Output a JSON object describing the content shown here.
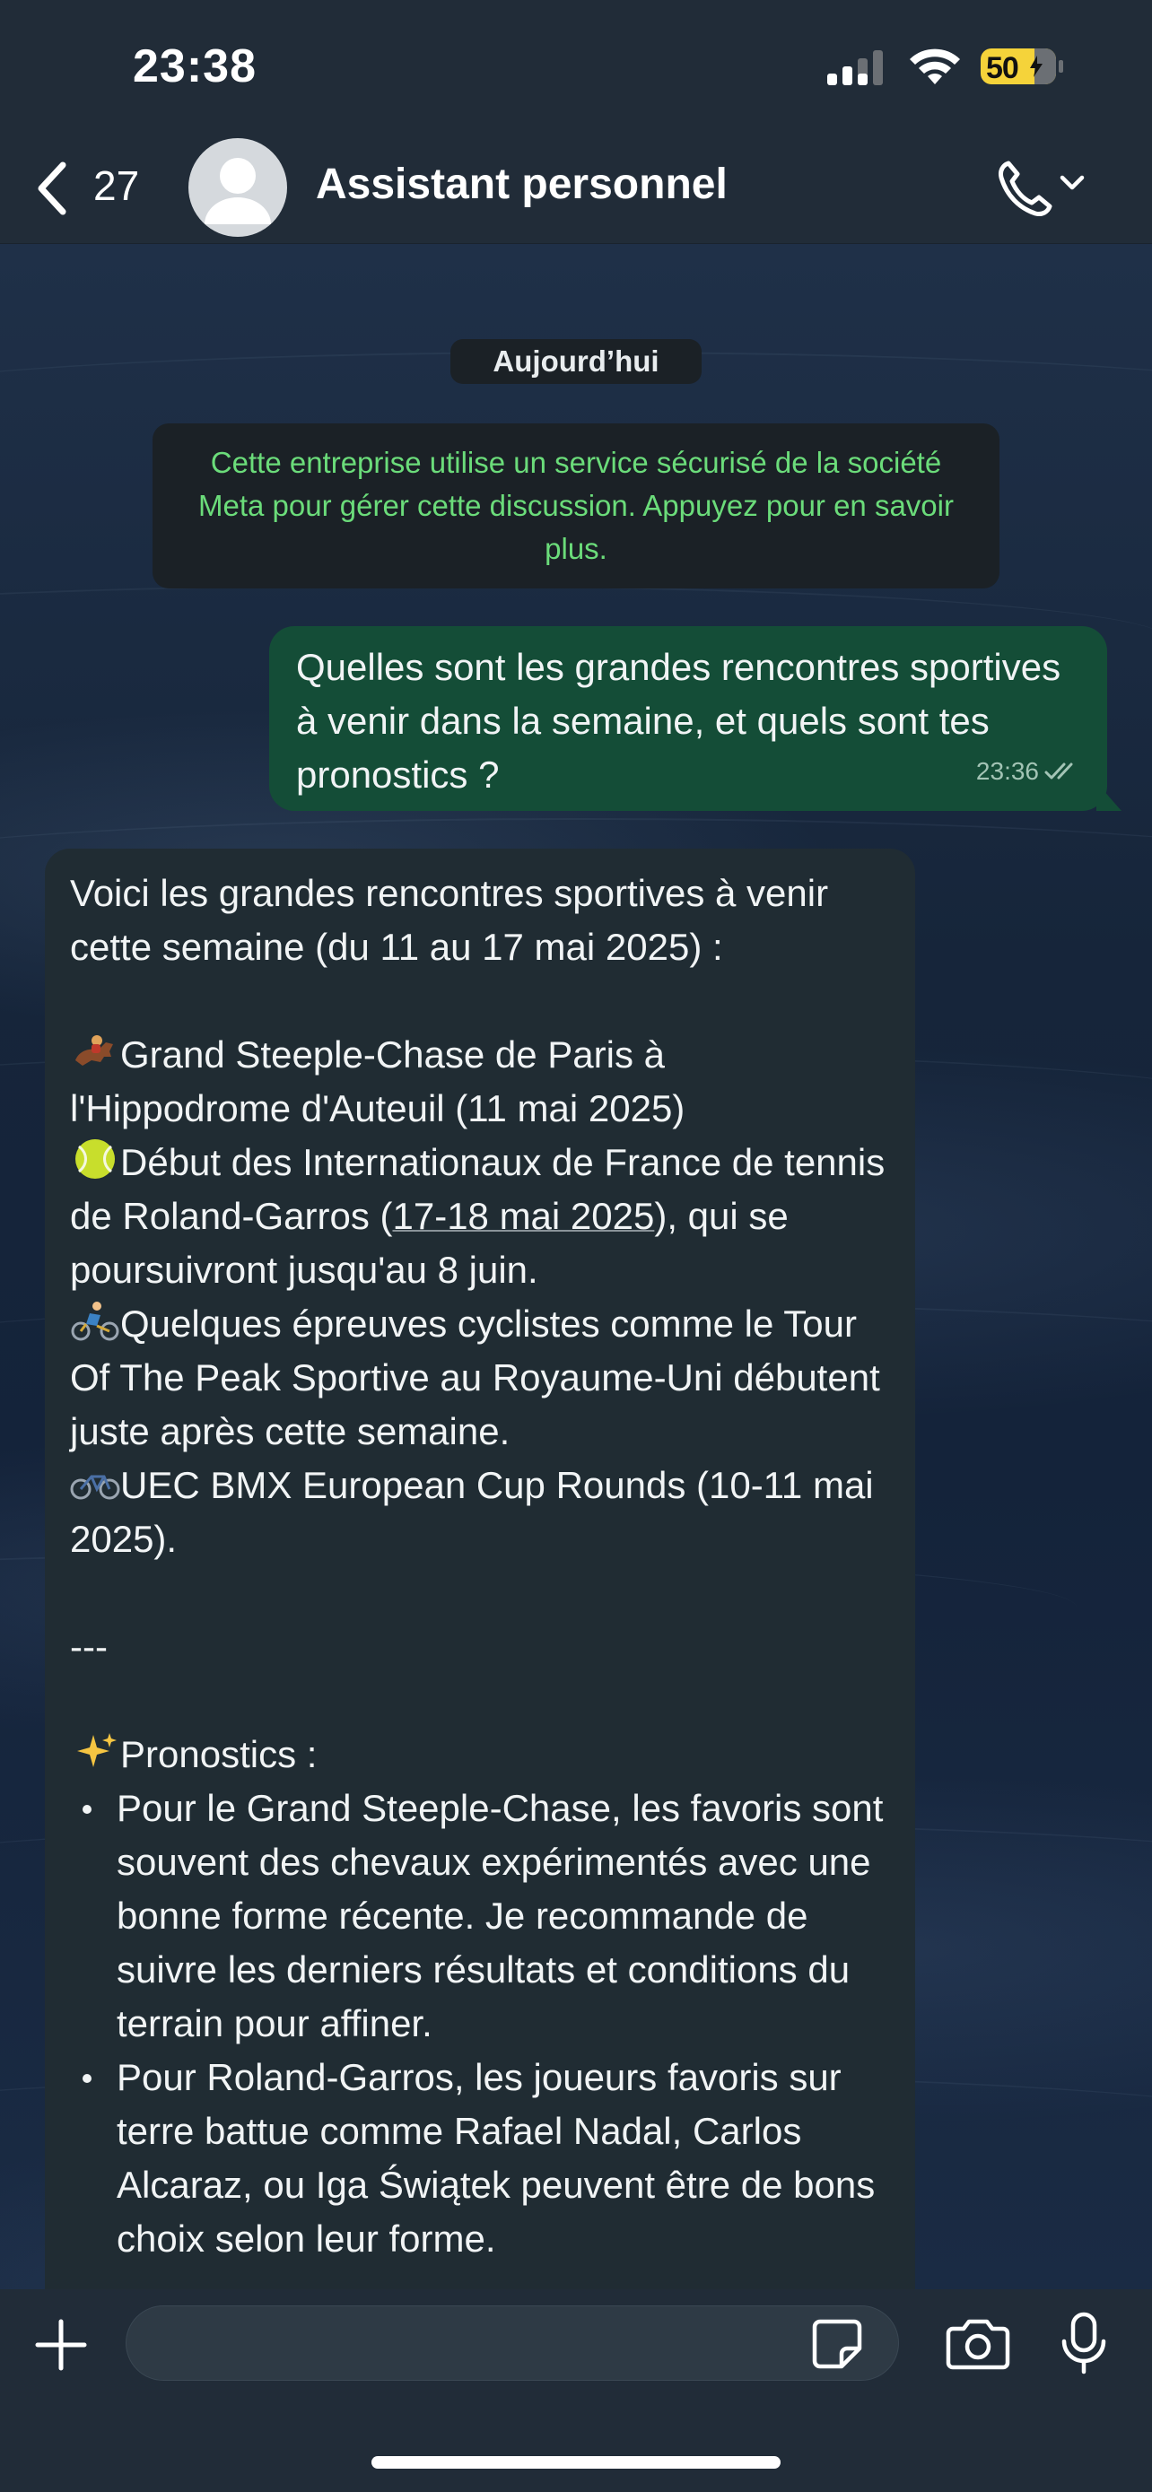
{
  "status_bar": {
    "time": "23:38",
    "battery_percent": "50"
  },
  "header": {
    "back_count": "27",
    "contact_name": "Assistant personnel"
  },
  "chat": {
    "date_chip": "Aujourd’hui",
    "notice": "Cette entreprise utilise un service sécurisé de la société Meta pour gérer cette discussion. Appuyez pour en savoir plus.",
    "outgoing": {
      "text": "Quelles sont les grandes rencontres sportives à venir dans la semaine, et quels sont tes pronostics ?",
      "time": "23:36"
    },
    "incoming": {
      "intro": "Voici les grandes rencontres sportives à venir cette semaine (du 11 au 17 mai 2025) :",
      "item1": "Grand Steeple-Chase de Paris à l'Hippodrome d'Auteuil (11 mai 2025)",
      "item2_a": "Début des Internationaux de France de tennis de Roland-Garros (",
      "item2_link": "17-18 mai 2025",
      "item2_b": "), qui se poursuivront jusqu'au 8 juin.",
      "item3": "Quelques épreuves cyclistes comme le Tour Of The Peak Sportive au Royaume-Uni débutent juste après cette semaine.",
      "item4": "UEC BMX European Cup Rounds (10-11 mai 2025).",
      "separator": "---",
      "pronostics_title": "Pronostics :",
      "bullet1": "Pour le Grand Steeple-Chase, les favoris sont souvent des chevaux expérimentés avec une bonne forme récente. Je recommande de suivre les derniers résultats et conditions du terrain pour affiner.",
      "bullet2": "Pour Roland-Garros, les joueurs favoris sur terre battue comme Rafael Nadal, Carlos Alcaraz, ou Iga Świątek peuvent être de bons choix selon leur forme."
    }
  },
  "input": {
    "placeholder": ""
  },
  "icons": {
    "item1": "horse-racing-icon",
    "item2": "tennis-ball-icon",
    "item3": "cyclist-icon",
    "item4": "bicycle-icon",
    "pronostics": "sparkles-icon"
  },
  "colors": {
    "outgoing_bubble": "#144d37",
    "incoming_bubble": "#202c33",
    "notice_text": "#6bdc7a",
    "battery": "#f5d33a"
  }
}
